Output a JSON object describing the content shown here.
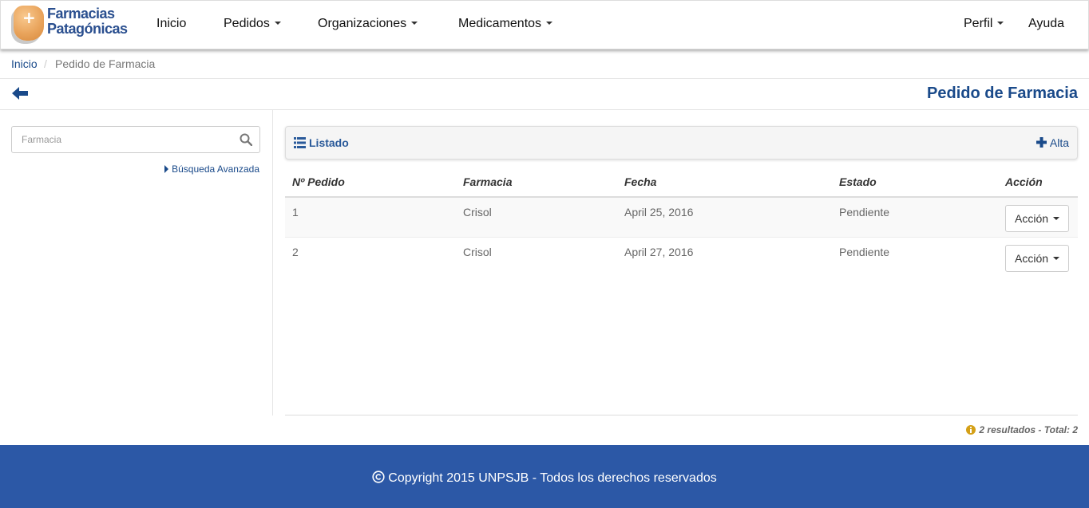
{
  "brand": {
    "line1": "Farmacias",
    "line2": "Patagónicas"
  },
  "nav": {
    "inicio": "Inicio",
    "pedidos": "Pedidos",
    "organizaciones": "Organizaciones",
    "medicamentos": "Medicamentos",
    "perfil": "Perfil",
    "ayuda": "Ayuda"
  },
  "breadcrumb": {
    "home": "Inicio",
    "separator": "/",
    "current": "Pedido de Farmacia"
  },
  "page": {
    "title": "Pedido de Farmacia"
  },
  "sidebar": {
    "search_placeholder": "Farmacia",
    "advanced_search": "Búsqueda Avanzada"
  },
  "panel": {
    "title": "Listado",
    "add_label": "Alta"
  },
  "table": {
    "headers": {
      "pedido": "Nº Pedido",
      "farmacia": "Farmacia",
      "fecha": "Fecha",
      "estado": "Estado",
      "accion": "Acción"
    },
    "rows": [
      {
        "pedido": "1",
        "farmacia": "Crisol",
        "fecha": "April 25, 2016",
        "estado": "Pendiente",
        "accion": "Acción"
      },
      {
        "pedido": "2",
        "farmacia": "Crisol",
        "fecha": "April 27, 2016",
        "estado": "Pendiente",
        "accion": "Acción"
      }
    ]
  },
  "results": {
    "summary": "2 resultados - Total: 2"
  },
  "footer": {
    "copyright": "Copyright 2015 UNPSJB - Todos los derechos reservados"
  },
  "colors": {
    "primary": "#1a4a8a",
    "footer_bg": "#2c58a6",
    "info": "#d4a017"
  }
}
